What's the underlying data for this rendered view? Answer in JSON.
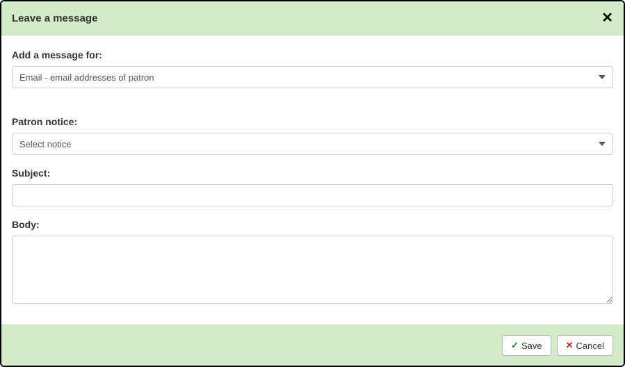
{
  "header": {
    "title": "Leave a message"
  },
  "form": {
    "messageFor": {
      "label": "Add a message for:",
      "selected": "Email - email addresses of patron"
    },
    "patronNotice": {
      "label": "Patron notice:",
      "selected": "Select notice"
    },
    "subject": {
      "label": "Subject:",
      "value": ""
    },
    "body": {
      "label": "Body:",
      "value": ""
    }
  },
  "footer": {
    "save": "Save",
    "cancel": "Cancel"
  }
}
